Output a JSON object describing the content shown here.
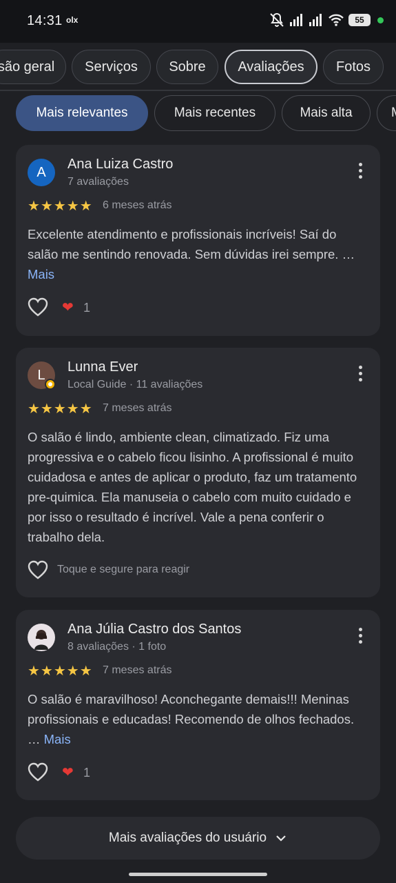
{
  "status_bar": {
    "time": "14:31",
    "app_indicator": "olx",
    "battery": "55",
    "icons": [
      "mute-icon",
      "signal-icon",
      "signal-icon",
      "wifi-icon",
      "battery-icon"
    ]
  },
  "tabs": [
    {
      "label": "são geral",
      "active": false
    },
    {
      "label": "Serviços",
      "active": false
    },
    {
      "label": "Sobre",
      "active": false
    },
    {
      "label": "Avaliações",
      "active": true
    },
    {
      "label": "Fotos",
      "active": false
    }
  ],
  "filters": [
    {
      "label": "Mais relevantes",
      "active": true
    },
    {
      "label": "Mais recentes",
      "active": false
    },
    {
      "label": "Mais alta",
      "active": false
    },
    {
      "label": "M",
      "active": false
    }
  ],
  "reviews": [
    {
      "author": "Ana Luiza Castro",
      "avatar_letter": "A",
      "avatar_color": "#1565c0",
      "meta": "7 avaliações",
      "rating": 5,
      "stars": "★★★★★",
      "when": "6 meses atrás",
      "text": "Excelente atendimento e profissionais incríveis! Saí do salão me sentindo renovada. Sem dúvidas irei sempre.",
      "ellipsis": "… ",
      "more_label": "Mais",
      "reaction_count": "1"
    },
    {
      "author": "Lunna Ever",
      "avatar_letter": "L",
      "avatar_color": "#6d4c41",
      "meta": "Local Guide · 11 avaliações",
      "rating": 5,
      "stars": "★★★★★",
      "when": "7 meses atrás",
      "text": "O salão é lindo, ambiente clean, climatizado. Fiz uma progressiva e o cabelo ficou lisinho. A profissional é muito cuidadosa e antes de aplicar o produto, faz um tratamento pre-quimica. Ela manuseia o cabelo com muito cuidado e por isso o resultado é incrível. Vale a pena conferir o trabalho dela.",
      "react_hint": "Toque e segure para reagir"
    },
    {
      "author": "Ana Júlia Castro dos Santos",
      "avatar_color": "#e9e2e6",
      "meta": "8 avaliações · 1 foto",
      "rating": 5,
      "stars": "★★★★★",
      "when": "7 meses atrás",
      "text": "O salão é maravilhoso! Aconchegante demais!!! Meninas profissionais e educadas! Recomendo de olhos fechados.",
      "ellipsis": " … ",
      "more_label": "Mais",
      "reaction_count": "1"
    }
  ],
  "more_reviews_button": "Mais avaliações do usuário"
}
